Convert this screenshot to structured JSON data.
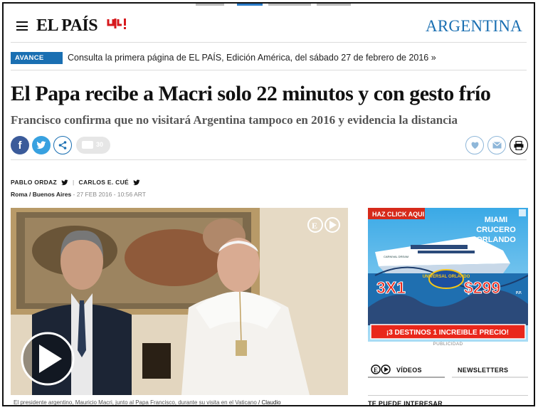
{
  "header": {
    "logo": "EL PAÍS",
    "logo_mark": "ꓤ!",
    "edition": "ARGENTINA"
  },
  "avance": {
    "badge": "AVANCE",
    "text": "Consulta la primera página de EL PAÍS, Edición América, del sábado 27 de febrero de 2016 »"
  },
  "article": {
    "headline": "El Papa recibe a Macri solo 22 minutos y con gesto frío",
    "subhead": "Francisco confirma que no visitará Argentina tampoco en 2016 y evidencia la distancia",
    "comments_count": "30",
    "authors": [
      "PABLO ORDAZ",
      "CARLOS E. CUÉ"
    ],
    "place": "Roma / Buenos Aires",
    "date": " - 27 FEB 2016 - 10:56 ",
    "tz": "ART",
    "caption": "El presidente argentino, Mauricio Macri, junto al Papa Francisco, durante su visita en el Vaticano",
    "caption_credit": "/ Claudio"
  },
  "ad": {
    "click": "HAZ CLICK AQUI",
    "line1": "MIAMI",
    "line2": "CRUCERO",
    "line3": "ORLANDO",
    "ship_name": "CARNIVAL DREAM",
    "badge": "UNIVERSAL ORLANDO",
    "offer": "3X1",
    "price": "$299",
    "price_suffix": "P.P.",
    "slogan": "¡3 DESTINOS 1 INCREIBLE PRECIO!",
    "label": "PUBLICIDAD"
  },
  "sidebar": {
    "tab_videos": "VÍDEOS",
    "tab_newsletters": "NEWSLETTERS",
    "interesar": "TE PUEDE INTERESAR"
  },
  "colors": {
    "brand_blue": "#1a6fb2",
    "brand_red": "#d6191d",
    "facebook": "#3b5b9a",
    "twitter": "#38a1e0"
  }
}
